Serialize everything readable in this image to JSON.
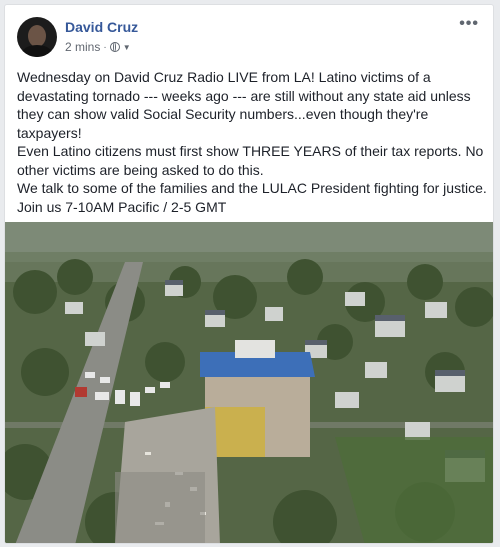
{
  "post": {
    "author": "David Cruz",
    "time": "2 mins",
    "separator": "·",
    "more_icon": "more-dots-icon",
    "privacy_icon": "globe-icon",
    "paragraphs": [
      "Wednesday on David Cruz Radio LIVE from LA! Latino victims of a devastating tornado --- weeks ago --- are still without any state aid unless they can show valid Social Security numbers...even though they're taxpayers!",
      "Even Latino citizens must first show THREE YEARS of their tax reports. No other victims are being asked to do this.",
      "We talk to some of the families and the LULAC President fighting for justice. Join us 7-10AM Pacific / 2-5 GMT"
    ]
  },
  "colors": {
    "link": "#365899",
    "text": "#1d2129",
    "meta": "#616770",
    "background": "#e9ebee"
  }
}
